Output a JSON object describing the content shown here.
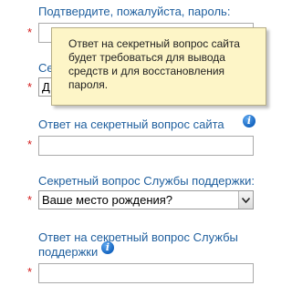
{
  "form": {
    "confirm_password": {
      "label": "Подтвердите, пожалуйста, пароль:",
      "required": "*",
      "value": ""
    },
    "site_question": {
      "label_partial": "Се",
      "value_partial": "Д",
      "required": "*"
    },
    "site_answer": {
      "label": "Ответ на секретный вопрос сайта",
      "required": "*",
      "value": ""
    },
    "support_question": {
      "label": "Секретный вопрос Службы поддержки:",
      "required": "*",
      "selected": "Ваше место рождения?"
    },
    "support_answer": {
      "label_line1": "Ответ на секретный вопрос Службы",
      "label_line2": "поддержки",
      "required": "*",
      "value": ""
    }
  },
  "tooltip": {
    "text": "Ответ на секретный вопрос сайта будет требоваться для вывода средств и для восстановления пароля."
  },
  "icons": {
    "info": "info-icon",
    "dropdown": "chevron-down-icon"
  },
  "info_glyph": "i",
  "colors": {
    "label": "#1f5f9e",
    "required": "#d21a1a",
    "tooltip_bg": "#fdf5c7",
    "info": "#1565c0"
  }
}
